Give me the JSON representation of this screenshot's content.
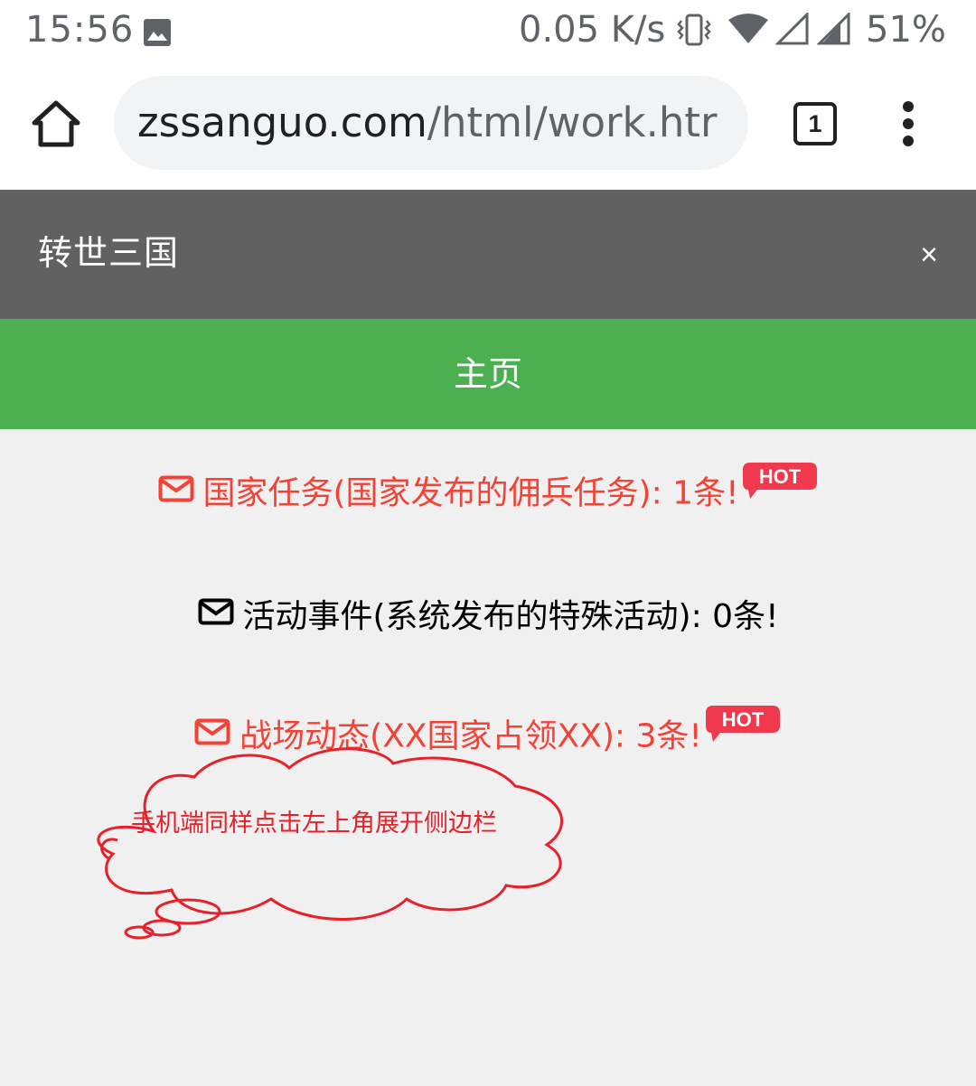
{
  "status_bar": {
    "time": "15:56",
    "network_speed": "0.05 K/s",
    "battery": "51%",
    "icons": [
      "image-icon",
      "vibrate-icon",
      "wifi-icon",
      "signal-icon",
      "signal-icon"
    ]
  },
  "browser": {
    "url_domain": "zssanguo.com",
    "url_path": "/html/work.htr",
    "tab_count": "1",
    "icons": [
      "home-icon",
      "menu-icon"
    ]
  },
  "site": {
    "title": "转世三国",
    "close_label": "×",
    "nav_home": "主页"
  },
  "messages": [
    {
      "text": "国家任务(国家发布的佣兵任务): 1条!",
      "icon": "mail-icon",
      "color": "#f44336",
      "hot": true,
      "hot_label": "HOT"
    },
    {
      "text": "活动事件(系统发布的特殊活动): 0条!",
      "icon": "mail-icon",
      "color": "#000000",
      "hot": false
    },
    {
      "text": "战场动态(XX国家占领XX): 3条!",
      "icon": "mail-icon",
      "color": "#f44336",
      "hot": true,
      "hot_label": "HOT"
    }
  ],
  "annotation": {
    "text": "手机端同样点击左上角展开侧边栏",
    "color": "#e8202a"
  },
  "colors": {
    "header_bg": "#616161",
    "nav_bg": "#4caf50",
    "page_bg": "#f0f0f0",
    "hot_badge": "#f0394d"
  }
}
